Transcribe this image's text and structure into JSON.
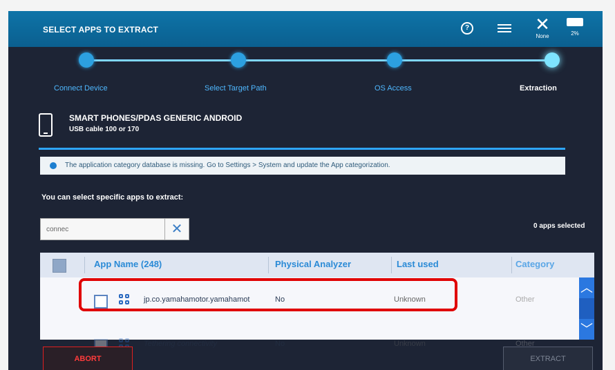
{
  "topbar": {
    "title": "SELECT APPS TO EXTRACT",
    "help_icon": "?",
    "network_label": "None",
    "battery_label": "2%"
  },
  "steps": [
    {
      "label": "Connect Device"
    },
    {
      "label": "Select Target Path"
    },
    {
      "label": "OS Access"
    },
    {
      "label": "Extraction"
    }
  ],
  "device": {
    "name": "SMART PHONES/PDAS GENERIC ANDROID",
    "connection": "USB cable 100 or 170"
  },
  "banner": {
    "text": "The application category database is missing. Go to Settings > System and update the App categorization."
  },
  "prompt": "You can select specific apps to extract:",
  "search": {
    "value": "connec",
    "clear_icon": "✕"
  },
  "selected_count": "0 apps selected",
  "table": {
    "headers": {
      "app_name": "App Name (248)",
      "physical_analyzer": "Physical Analyzer",
      "last_used": "Last used",
      "category": "Category"
    },
    "rows": [
      {
        "name": "jp.co.yamahamotor.yamahamot",
        "physical": "No",
        "last_used": "Unknown",
        "category": "Other"
      },
      {
        "name": "Tethering connectivity",
        "physical": "No",
        "last_used": "Unknown",
        "category": "Other"
      }
    ]
  },
  "buttons": {
    "abort": "ABORT",
    "extract": "EXTRACT"
  },
  "colors": {
    "accent": "#2ea6ff",
    "highlight": "#e00000",
    "abort": "#e02020"
  }
}
